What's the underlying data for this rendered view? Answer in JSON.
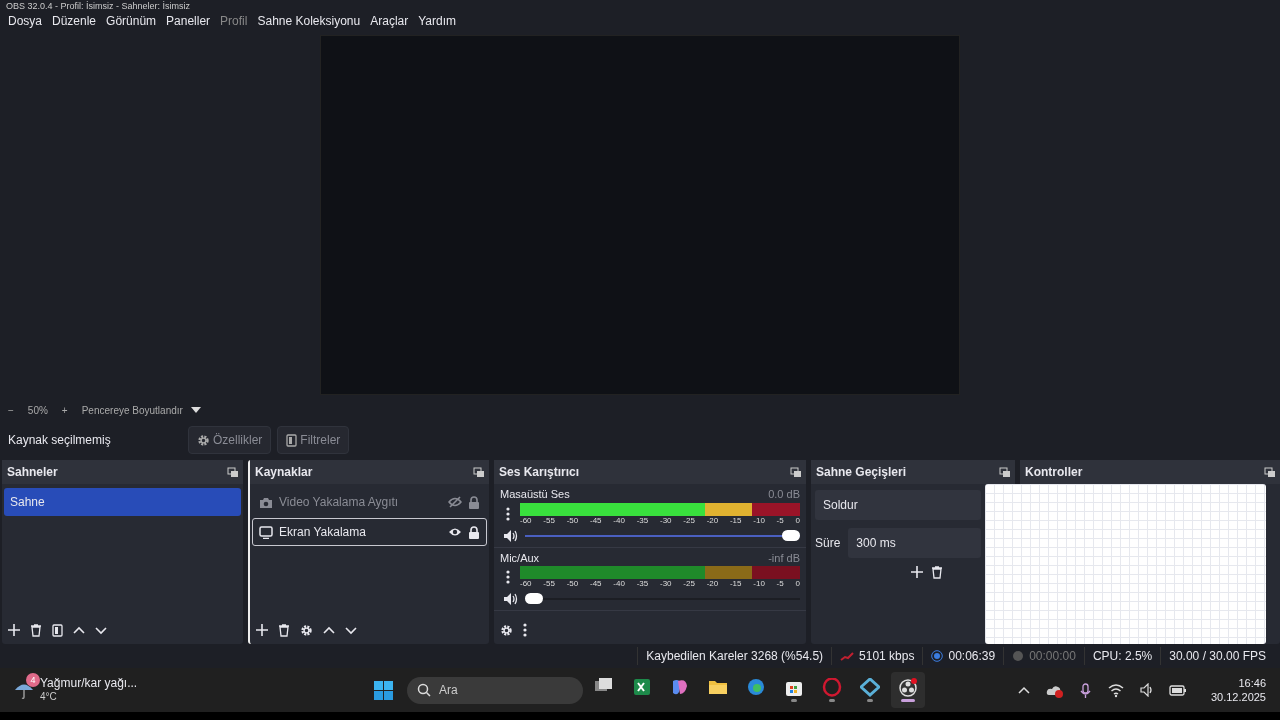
{
  "window": {
    "title": "OBS 32.0.4 - Profil: İsimsiz - Sahneler: İsimsiz"
  },
  "menu": [
    {
      "label": "Dosya",
      "disabled": false
    },
    {
      "label": "Düzenle",
      "disabled": false
    },
    {
      "label": "Görünüm",
      "disabled": false
    },
    {
      "label": "Paneller",
      "disabled": false
    },
    {
      "label": "Profil",
      "disabled": true
    },
    {
      "label": "Sahne Koleksiyonu",
      "disabled": false
    },
    {
      "label": "Araçlar",
      "disabled": false
    },
    {
      "label": "Yardım",
      "disabled": false
    }
  ],
  "preview_bar": {
    "zoom_out": "−",
    "zoom": "50%",
    "zoom_in": "+",
    "scale_mode": "Pencereye Boyutlandır"
  },
  "context_bar": {
    "label": "Kaynak seçilmemiş",
    "buttons": [
      {
        "label": "Özellikler",
        "kind": "gear"
      },
      {
        "label": "Filtreler",
        "kind": "filter"
      }
    ]
  },
  "scenes": {
    "title": "Sahneler",
    "items": [
      {
        "label": "Sahne",
        "selected": true
      }
    ]
  },
  "sources": {
    "title": "Kaynaklar",
    "items": [
      {
        "label": "Video Yakalama Aygıtı",
        "kind": "camera",
        "visible": false,
        "selected": false
      },
      {
        "label": "Ekran Yakalama",
        "kind": "display",
        "visible": true,
        "selected": true
      }
    ]
  },
  "audio_mixer": {
    "title": "Ses Karıştırıcı",
    "channels": [
      {
        "name": "Masaüstü Ses",
        "reading": "0.0 dB",
        "signal": true,
        "level": 1,
        "scale": [
          "-60",
          "-55",
          "-50",
          "-45",
          "-40",
          "-35",
          "-30",
          "-25",
          "-20",
          "-15",
          "-10",
          "-5",
          "0"
        ]
      },
      {
        "name": "Mic/Aux",
        "reading": "-inf dB",
        "signal": false,
        "level": 0,
        "scale": [
          "-60",
          "-55",
          "-50",
          "-45",
          "-40",
          "-35",
          "-30",
          "-25",
          "-20",
          "-15",
          "-10",
          "-5",
          "0"
        ]
      }
    ]
  },
  "transitions": {
    "title": "Sahne Geçişleri",
    "transition": "Soldur",
    "duration_label": "Süre",
    "duration": "300 ms"
  },
  "controls": {
    "title": "Kontroller"
  },
  "status_bar": {
    "dropped_frames": "Kaybedilen Kareler 3268 (%54.5)",
    "bitrate": "5101 kbps",
    "stream_time": "00:06:39",
    "record_time": "00:00:00",
    "cpu": "CPU: 2.5%",
    "fps": "30.00 / 30.00 FPS"
  },
  "taskbar": {
    "weather": {
      "badge": "4",
      "title": "Yağmur/kar yağı...",
      "temperature": "4°C"
    },
    "search": {
      "placeholder": "Ara"
    },
    "apps": [
      {
        "kind": "taskview",
        "running": false,
        "active": false
      },
      {
        "kind": "sheet",
        "running": false,
        "active": false
      },
      {
        "kind": "copilot",
        "running": false,
        "active": false
      },
      {
        "kind": "folder",
        "running": false,
        "active": false
      },
      {
        "kind": "edge",
        "running": false,
        "active": false
      },
      {
        "kind": "store",
        "running": true,
        "active": false
      },
      {
        "kind": "opera",
        "running": true,
        "active": false
      },
      {
        "kind": "diamond",
        "running": true,
        "active": false
      },
      {
        "kind": "obs",
        "running": true,
        "active": true
      }
    ],
    "time": "16:46",
    "date": "30.12.2025"
  }
}
